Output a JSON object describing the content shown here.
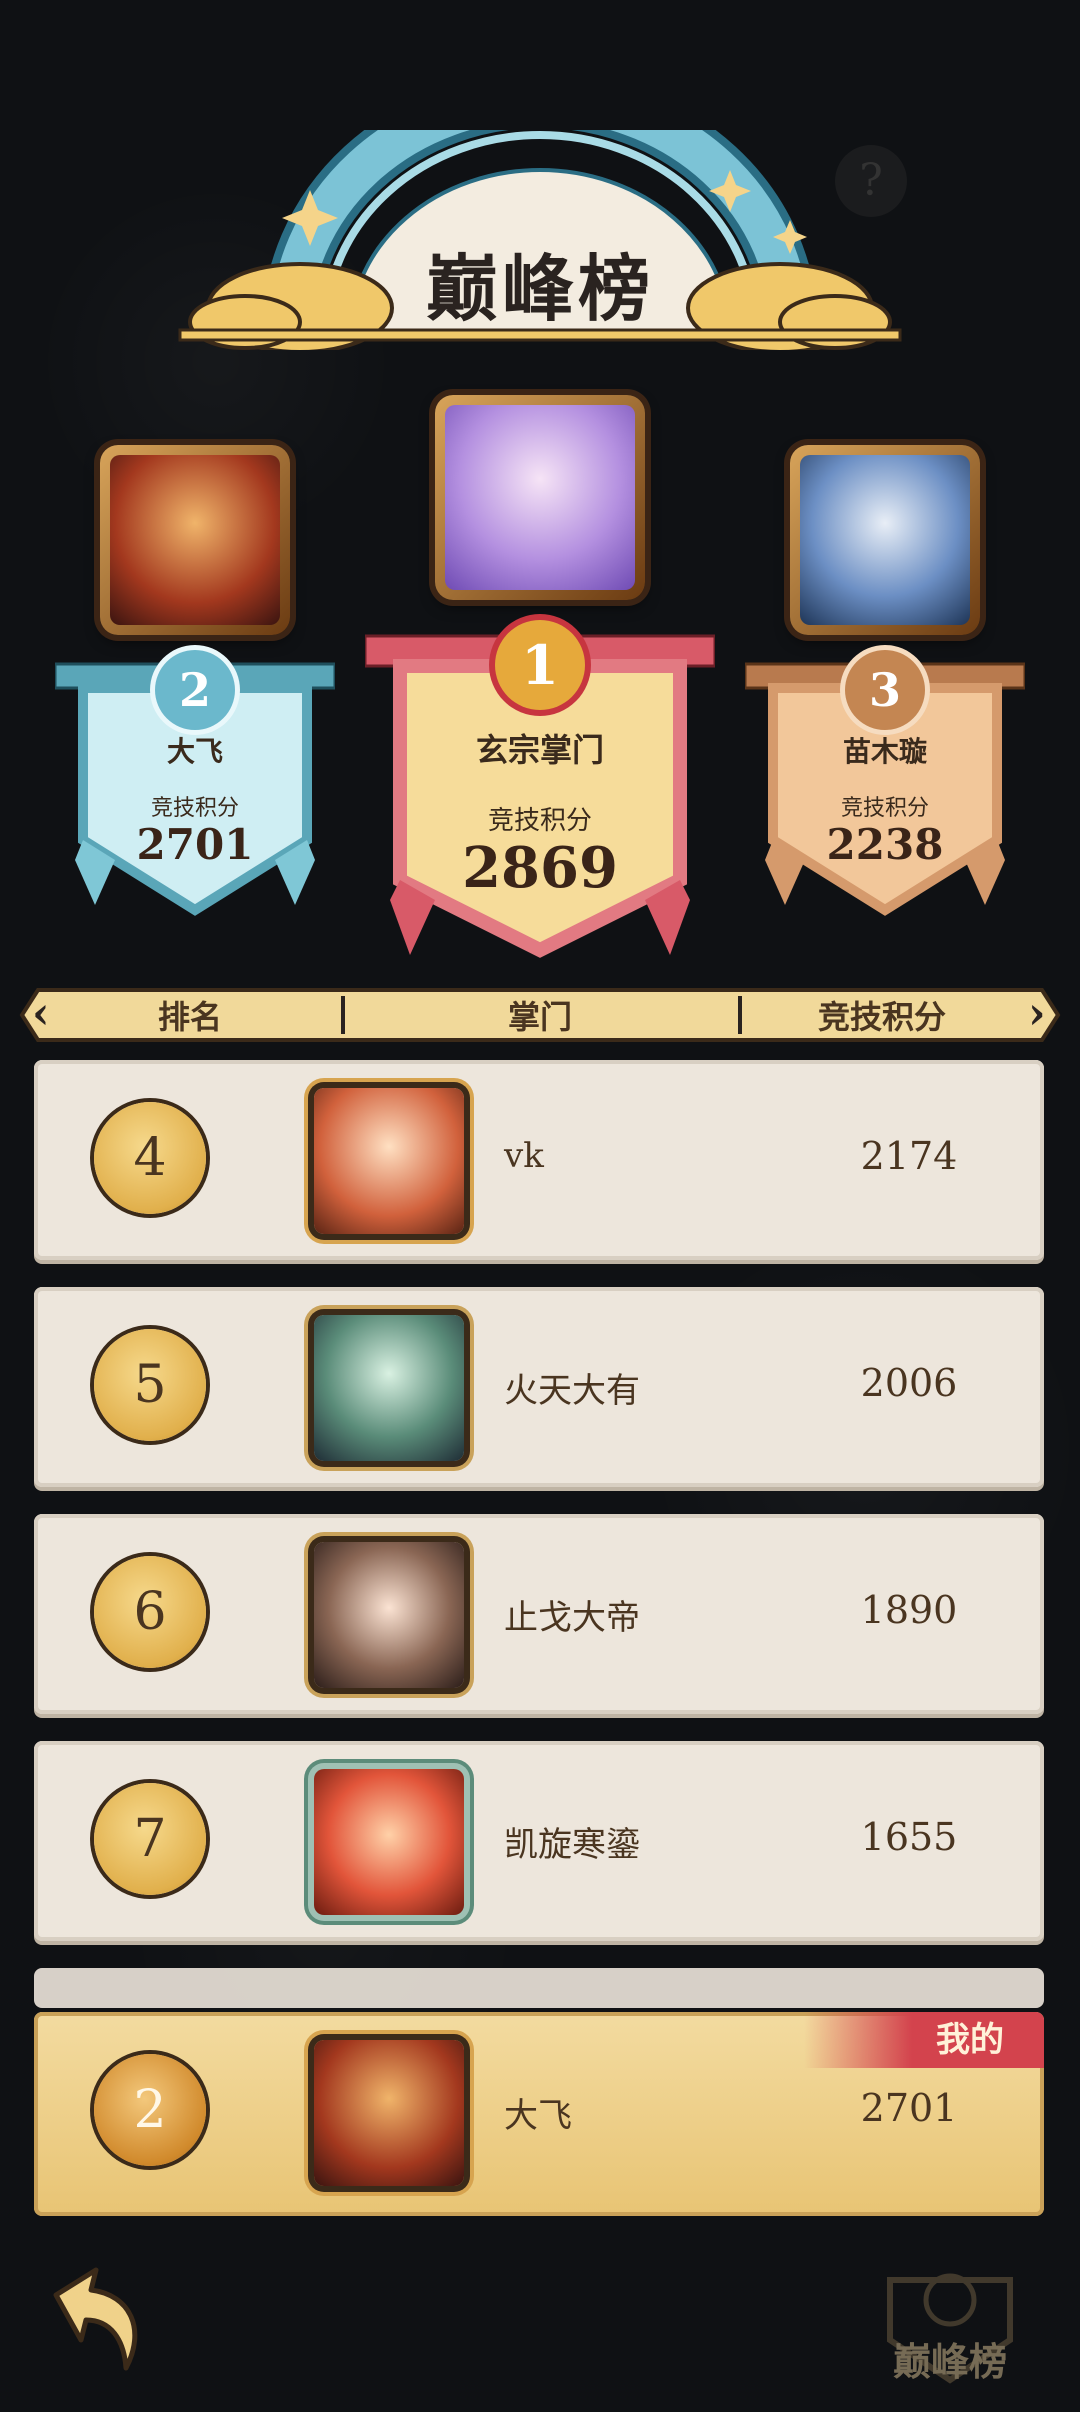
{
  "title": "巅峰榜",
  "help_icon": "question-icon",
  "podium": [
    {
      "rank": "2",
      "name": "大飞",
      "score_label": "竞技积分",
      "score": "2701",
      "color": "#7fc7d6"
    },
    {
      "rank": "1",
      "name": "玄宗掌门",
      "score_label": "竞技积分",
      "score": "2869",
      "color": "#e27a82"
    },
    {
      "rank": "3",
      "name": "苗木璇",
      "score_label": "竞技积分",
      "score": "2238",
      "color": "#d59a6c"
    }
  ],
  "columns": {
    "rank": "排名",
    "name": "掌门",
    "score": "竞技积分"
  },
  "rows": [
    {
      "rank": "4",
      "name": "vk",
      "score": "2174"
    },
    {
      "rank": "5",
      "name": "火天大有",
      "score": "2006"
    },
    {
      "rank": "6",
      "name": "止戈大帝",
      "score": "1890"
    },
    {
      "rank": "7",
      "name": "凯旋寒鎏",
      "score": "1655"
    }
  ],
  "mine": {
    "tag": "我的",
    "rank": "2",
    "name": "大飞",
    "score": "2701"
  },
  "corner_logo": "巅峰榜"
}
